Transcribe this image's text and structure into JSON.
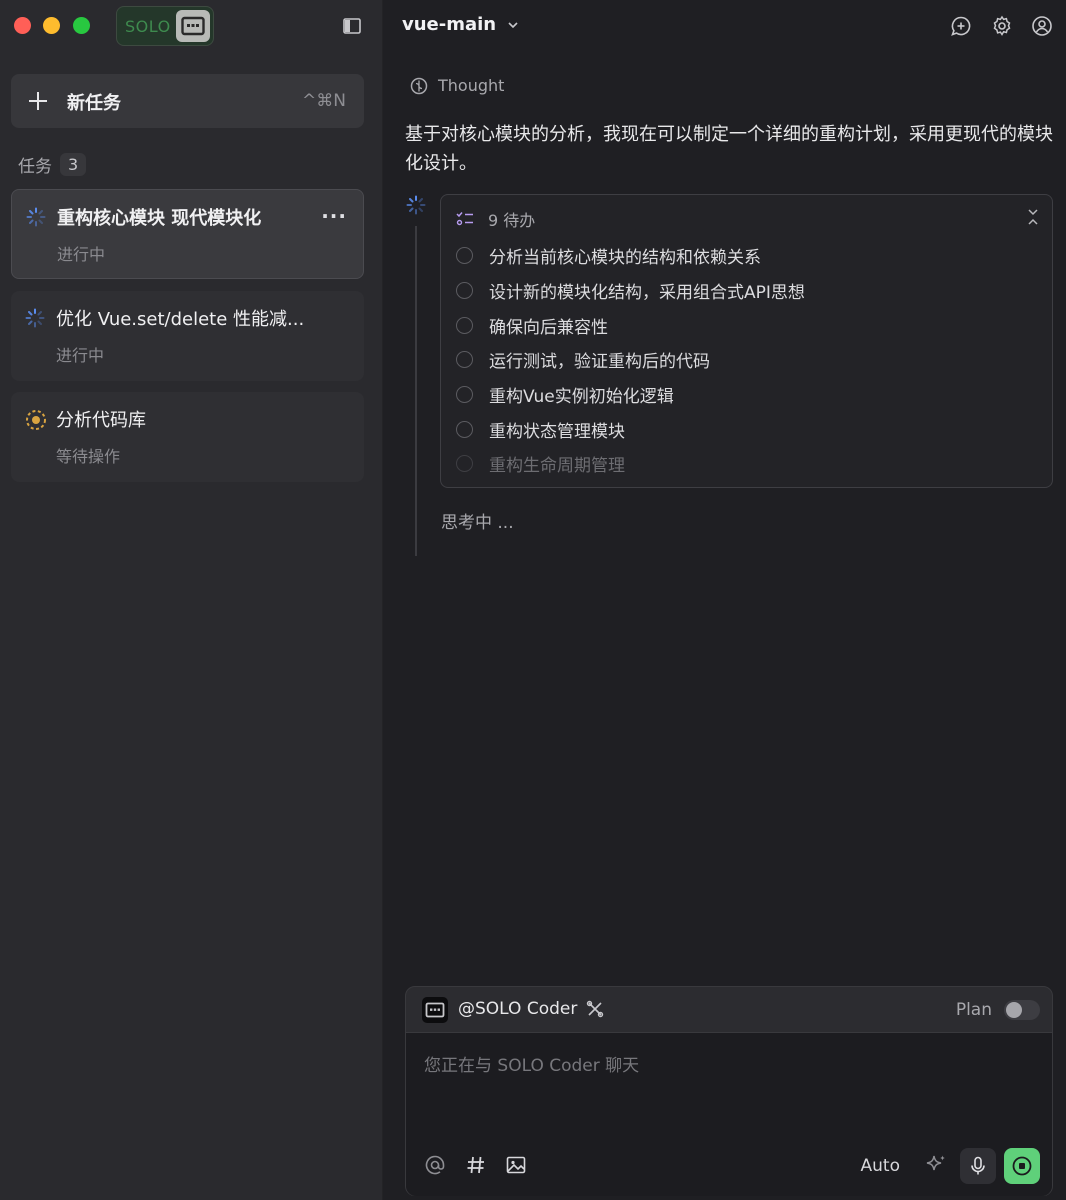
{
  "app": {
    "brand_text": "SOLO",
    "sidebar": {
      "new_task": {
        "label": "新任务",
        "shortcut": "^⌘N"
      },
      "tasks_header": {
        "label": "任务",
        "count": "3"
      },
      "tasks": [
        {
          "title": "重构核心模块 现代模块化",
          "status": "进行中",
          "state": "in-progress",
          "active": true
        },
        {
          "title": "优化 Vue.set/delete 性能减...",
          "status": "进行中",
          "state": "in-progress",
          "active": false
        },
        {
          "title": "分析代码库",
          "status": "等待操作",
          "state": "waiting",
          "active": false
        }
      ]
    },
    "header": {
      "repo": "vue-main"
    },
    "conversation": {
      "thought_label": "Thought",
      "paragraph": "基于对核心模块的分析，我现在可以制定一个详细的重构计划，采用更现代的模块化设计。",
      "todo": {
        "header": "9 待办",
        "items": [
          {
            "text": "分析当前核心模块的结构和依赖关系",
            "faded": false
          },
          {
            "text": "设计新的模块化结构，采用组合式API思想",
            "faded": false
          },
          {
            "text": "确保向后兼容性",
            "faded": false
          },
          {
            "text": "运行测试，验证重构后的代码",
            "faded": false
          },
          {
            "text": "重构Vue实例初始化逻辑",
            "faded": false
          },
          {
            "text": "重构状态管理模块",
            "faded": false
          },
          {
            "text": "重构生命周期管理",
            "faded": true
          }
        ]
      },
      "thinking": "思考中 ..."
    },
    "composer": {
      "agent": "@SOLO Coder",
      "plan_label": "Plan",
      "plan_enabled": false,
      "placeholder": "您正在与 SOLO Coder 聊天",
      "mode": "Auto"
    },
    "colors": {
      "accent_green": "#5fd07a",
      "spinner_blue": "#5b8def",
      "waiting_yellow": "#d9a441"
    }
  }
}
